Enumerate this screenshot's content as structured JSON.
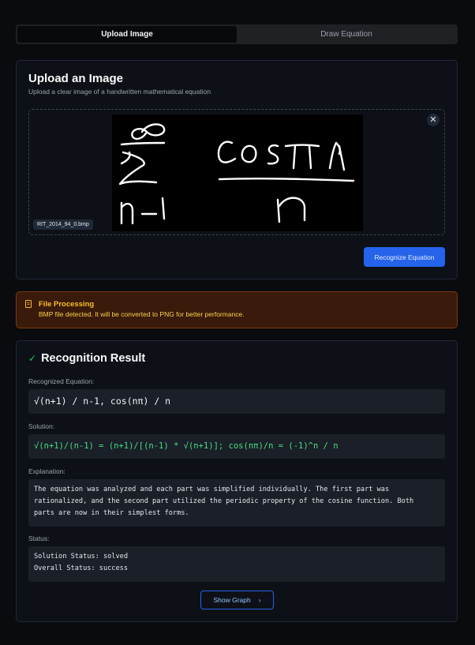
{
  "tabs": [
    {
      "label": "Upload Image",
      "active": true
    },
    {
      "label": "Draw Equation",
      "active": false
    }
  ],
  "upload": {
    "title": "Upload an Image",
    "subtitle": "Upload a clear image of a handwritten mathematical equation",
    "filename": "RIT_2014_94_0.bmp",
    "remove_icon": "close-icon",
    "recognize_label": "Recognize Equation"
  },
  "alert": {
    "icon": "file-icon",
    "title": "File Processing",
    "message": "BMP file detected. It will be converted to PNG for better performance."
  },
  "result": {
    "icon": "check-icon",
    "title": "Recognition Result",
    "equation_label": "Recognized Equation:",
    "equation": "√(n+1) / n-1, cos(nπ) / n",
    "solution_label": "Solution:",
    "solution": "√(n+1)/(n-1) = (n+1)/[(n-1) * √(n+1)]; cos(nπ)/n = (-1)^n / n",
    "explanation_label": "Explanation:",
    "explanation_lines": [
      "The equation was analyzed and each part was simplified individually. The first part was",
      "rationalized, and the second part utilized the periodic property of the cosine function. Both",
      "parts are now in their simplest forms."
    ],
    "status_label": "Status:",
    "status_lines": [
      "Solution Status: solved",
      "Overall Status: success"
    ],
    "graph_label": "Show Graph",
    "graph_icon": "chevron-right-icon"
  },
  "colors": {
    "accent": "#2563eb",
    "success": "#22c55e",
    "warning": "#fbbf24"
  }
}
